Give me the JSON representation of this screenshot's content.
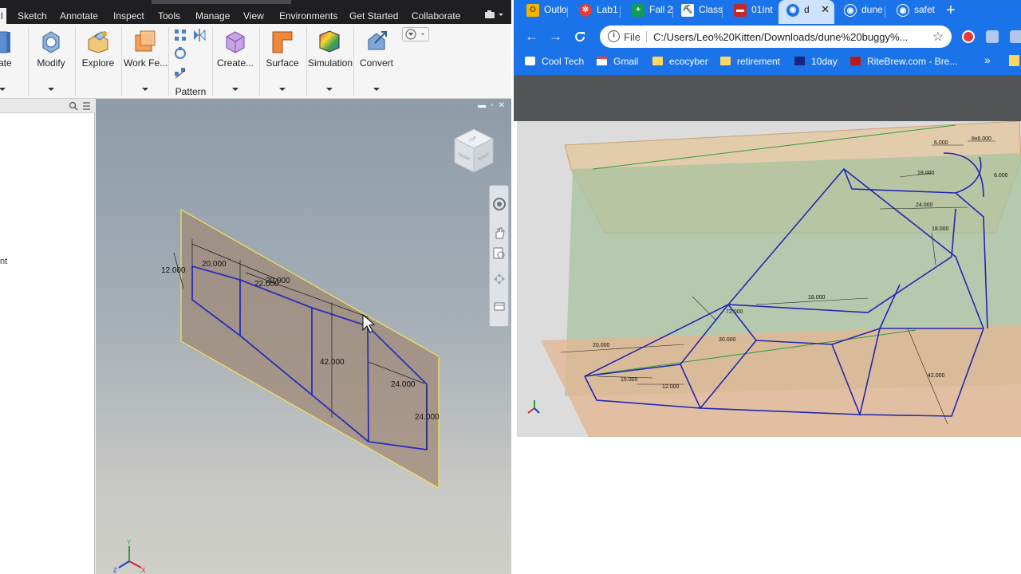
{
  "cad": {
    "ribbon_tabs": [
      "l",
      "Sketch",
      "Annotate",
      "Inspect",
      "Tools",
      "Manage",
      "View",
      "Environments",
      "Get Started",
      "Collaborate"
    ],
    "ribbon_buttons": {
      "create": "eate",
      "modify": "Modify",
      "explore": "Explore",
      "work_features": "Work Fe...",
      "pattern": "Pattern",
      "create_freeform": "Create...",
      "surface": "Surface",
      "simulation": "Simulation",
      "convert": "Convert"
    },
    "browser_snippet": "nt",
    "sketch_dims": [
      "20.000",
      "12.000",
      "22.000",
      "20.000",
      "42.000",
      "24.000",
      "24.000"
    ],
    "viewcube": {
      "top": "TOP",
      "front": "FRONT",
      "right": "RIGHT"
    }
  },
  "chrome": {
    "tabs": [
      {
        "title": "Outlo",
        "color": "#f4b400",
        "glyph": "O"
      },
      {
        "title": "Lab1",
        "color": "#e53935",
        "glyph": "✲"
      },
      {
        "title": "Fall 2",
        "color": "#0f9d58",
        "glyph": "+"
      },
      {
        "title": "Class",
        "color": "#f5f5f5",
        "glyph": "⛏"
      },
      {
        "title": "01Int",
        "color": "#c62828",
        "glyph": "▬"
      },
      {
        "title": "d",
        "color": "#1a73e8",
        "glyph": "◉",
        "active": true
      },
      {
        "title": "dune",
        "color": "#1a73e8",
        "glyph": "◉"
      },
      {
        "title": "safet",
        "color": "#1a73e8",
        "glyph": "◉"
      }
    ],
    "new_tab": "+",
    "omnibox": {
      "scheme": "File",
      "url": "C:/Users/Leo%20Kitten/Downloads/dune%20buggy%..."
    },
    "bookmarks": [
      {
        "label": "Cool Tech",
        "color": "#1a73e8"
      },
      {
        "label": "Gmail",
        "color": "#ea4335"
      },
      {
        "label": "ecocyber",
        "color": "#fdd663"
      },
      {
        "label": "retirement",
        "color": "#fdd663"
      },
      {
        "label": "10day",
        "color": "#1a237e"
      },
      {
        "label": "RiteBrew.com - Bre...",
        "color": "#b71c1c"
      }
    ],
    "bookmarks_more": "»",
    "drawing_dims": [
      "6.000",
      "8x6.000",
      "18.000",
      "6.000",
      "24.000",
      "18.000",
      "18.000",
      "72.000",
      "30.000",
      "20.000",
      "15.000",
      "12.000",
      "42.000"
    ]
  }
}
